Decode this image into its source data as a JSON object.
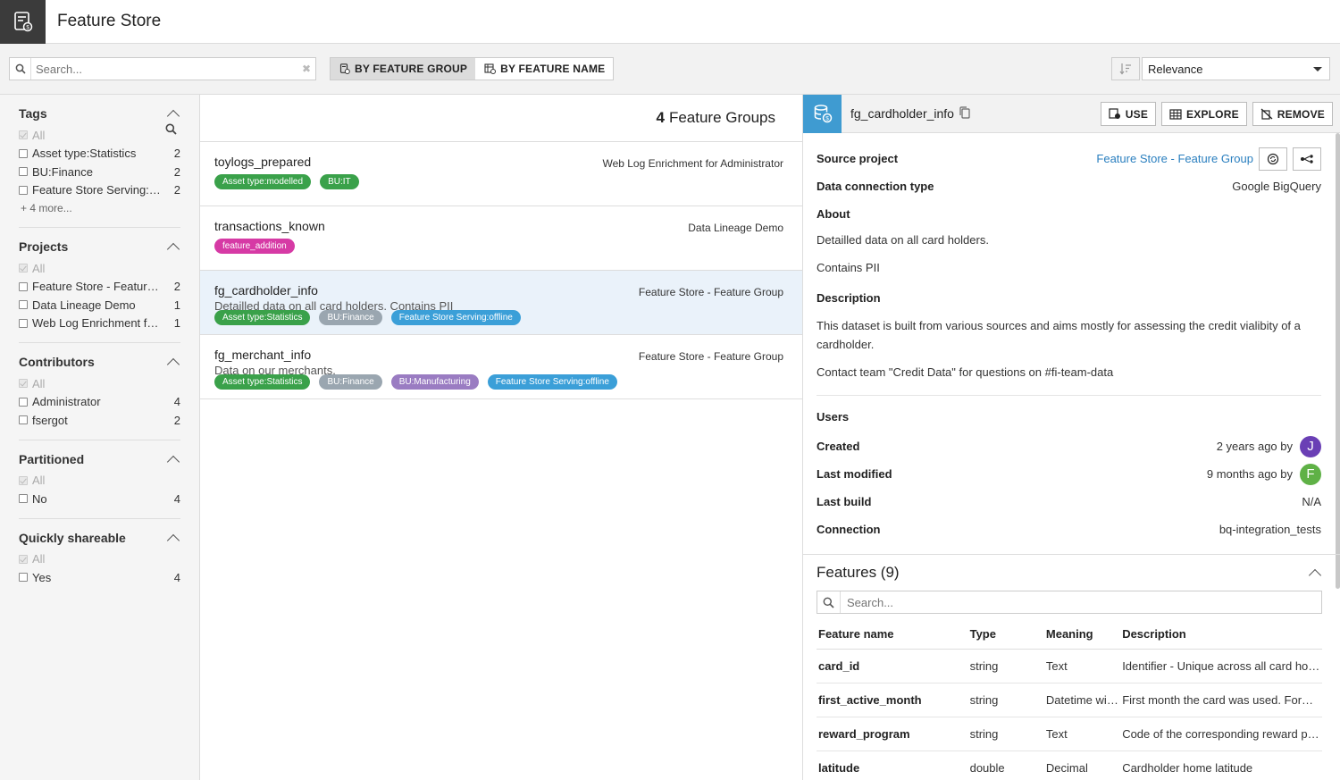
{
  "app": {
    "title": "Feature Store"
  },
  "toolbar": {
    "search_placeholder": "Search...",
    "by_group": "BY FEATURE GROUP",
    "by_name": "BY FEATURE NAME",
    "sort_value": "Relevance"
  },
  "sidebar": {
    "tags": {
      "title": "Tags",
      "all": "All",
      "items": [
        {
          "label": "Asset type:Statistics",
          "count": "2"
        },
        {
          "label": "BU:Finance",
          "count": "2"
        },
        {
          "label": "Feature Store Serving:offline",
          "count": "2"
        }
      ],
      "more": "+ 4 more..."
    },
    "projects": {
      "title": "Projects",
      "all": "All",
      "items": [
        {
          "label": "Feature Store - Feature Group",
          "count": "2"
        },
        {
          "label": "Data Lineage Demo",
          "count": "1"
        },
        {
          "label": "Web Log Enrichment for Administrator",
          "count": "1"
        }
      ]
    },
    "contributors": {
      "title": "Contributors",
      "all": "All",
      "items": [
        {
          "label": "Administrator",
          "count": "4"
        },
        {
          "label": "fsergot",
          "count": "2"
        }
      ]
    },
    "partitioned": {
      "title": "Partitioned",
      "all": "All",
      "items": [
        {
          "label": "No",
          "count": "4"
        }
      ]
    },
    "shareable": {
      "title": "Quickly shareable",
      "all": "All",
      "items": [
        {
          "label": "Yes",
          "count": "4"
        }
      ]
    }
  },
  "list": {
    "count": "4",
    "count_label": "Feature Groups",
    "items": [
      {
        "name": "toylogs_prepared",
        "project": "Web Log Enrichment for Administrator",
        "description": "",
        "tags": [
          {
            "label": "Asset type:modelled",
            "color": "#3aa14a"
          },
          {
            "label": "BU:IT",
            "color": "#3aa14a"
          }
        ]
      },
      {
        "name": "transactions_known",
        "project": "Data Lineage Demo",
        "description": "",
        "tags": [
          {
            "label": "feature_addition",
            "color": "#d63aa5"
          }
        ]
      },
      {
        "name": "fg_cardholder_info",
        "project": "Feature Store - Feature Group",
        "description": "Detailled data on all card holders. Contains PII",
        "tags": [
          {
            "label": "Asset type:Statistics",
            "color": "#3aa14a"
          },
          {
            "label": "BU:Finance",
            "color": "#9aa6b0"
          },
          {
            "label": "Feature Store Serving:offline",
            "color": "#3b9fd8"
          }
        ]
      },
      {
        "name": "fg_merchant_info",
        "project": "Feature Store - Feature Group",
        "description": "Data on our merchants.",
        "tags": [
          {
            "label": "Asset type:Statistics",
            "color": "#3aa14a"
          },
          {
            "label": "BU:Finance",
            "color": "#9aa6b0"
          },
          {
            "label": "BU:Manufacturing",
            "color": "#9a7cc2"
          },
          {
            "label": "Feature Store Serving:offline",
            "color": "#3b9fd8"
          }
        ]
      }
    ]
  },
  "panel": {
    "title": "fg_cardholder_info",
    "use": "USE",
    "explore": "EXPLORE",
    "remove": "REMOVE",
    "source_project_label": "Source project",
    "source_project_value": "Feature Store - Feature Group",
    "connection_type_label": "Data connection type",
    "connection_type_value": "Google BigQuery",
    "about_label": "About",
    "about_line1": "Detailled data on all card holders.",
    "about_line2": "Contains PII",
    "description_label": "Description",
    "description_text": "This dataset is built from various sources and aims mostly for assessing the credit vialibity of a cardholder.",
    "description_contact": "Contact team \"Credit Data\" for questions on #fi-team-data",
    "users_label": "Users",
    "created_label": "Created",
    "created_value": "2 years ago by",
    "created_avatar": "J",
    "created_avatar_color": "#6a3fb5",
    "modified_label": "Last modified",
    "modified_value": "9 months ago by",
    "modified_avatar": "F",
    "modified_avatar_color": "#5fb146",
    "build_label": "Last build",
    "build_value": "N/A",
    "conn_label": "Connection",
    "conn_value": "bq-integration_tests",
    "accent": "#3f9bd1"
  },
  "features": {
    "title": "Features (9)",
    "search_placeholder": "Search...",
    "columns": [
      "Feature name",
      "Type",
      "Meaning",
      "Description"
    ],
    "rows": [
      [
        "card_id",
        "string",
        "Text",
        "Identifier - Unique across all card holders"
      ],
      [
        "first_active_month",
        "string",
        "Datetime with tz",
        "First month the card was used. Format YYYY-MM"
      ],
      [
        "reward_program",
        "string",
        "Text",
        "Code of the corresponding reward program"
      ],
      [
        "latitude",
        "double",
        "Decimal",
        "Cardholder home latitude"
      ]
    ]
  }
}
